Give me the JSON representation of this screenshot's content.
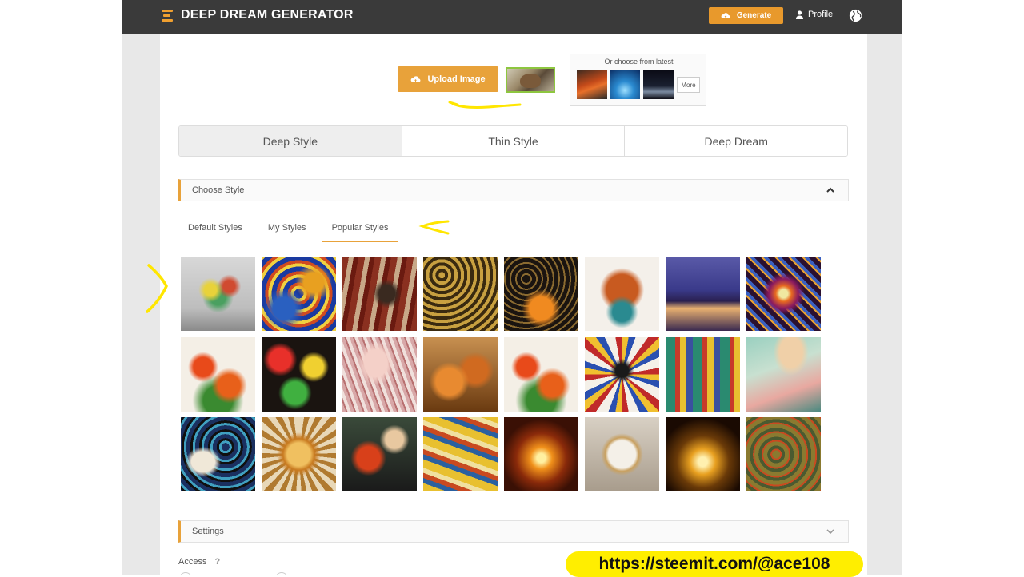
{
  "header": {
    "app_name": "DEEP DREAM GENERATOR",
    "generate_label": "Generate",
    "profile_label": "Profile"
  },
  "upload": {
    "button_label": "Upload Image"
  },
  "latest": {
    "title": "Or choose from latest",
    "more_label": "More"
  },
  "mode_tabs": [
    {
      "label": "Deep Style",
      "active": true
    },
    {
      "label": "Thin Style",
      "active": false
    },
    {
      "label": "Deep Dream",
      "active": false
    }
  ],
  "choose_style": {
    "title": "Choose Style",
    "subtabs": [
      {
        "label": "Default Styles",
        "active": false
      },
      {
        "label": "My Styles",
        "active": false
      },
      {
        "label": "Popular Styles",
        "active": true
      }
    ]
  },
  "settings": {
    "title": "Settings"
  },
  "access": {
    "label": "Access",
    "help": "?"
  },
  "watermark": "https://steemit.com/@ace108",
  "colors": {
    "accent": "#e8a23a",
    "topbar": "#3a3a3a",
    "annotation": "#ffee00"
  },
  "icons": {
    "logo": "stack-bars-icon",
    "generate": "cloud-upload-icon",
    "upload": "cloud-upload-icon",
    "profile": "user-icon",
    "language": "globe-icon",
    "collapse": "chevron-up-icon",
    "expand": "chevron-down-icon"
  }
}
